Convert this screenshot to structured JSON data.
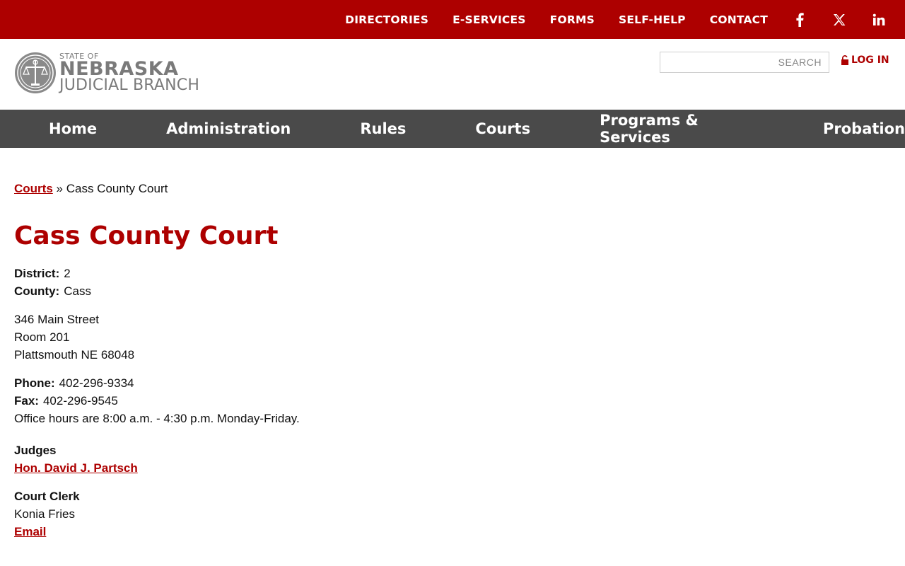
{
  "top_nav": {
    "items": [
      "DIRECTORIES",
      "E-SERVICES",
      "FORMS",
      "SELF-HELP",
      "CONTACT"
    ],
    "social": [
      "facebook-icon",
      "x-icon",
      "linkedin-icon"
    ]
  },
  "header": {
    "logo": {
      "state_of": "STATE OF",
      "nebraska": "NEBRASKA",
      "judicial_branch": "JUDICIAL BRANCH"
    },
    "search_placeholder": "SEARCH",
    "login_label": "LOG IN"
  },
  "main_nav": [
    "Home",
    "Administration",
    "Rules",
    "Courts",
    "Programs & Services",
    "Probation"
  ],
  "breadcrumb": {
    "link": "Courts",
    "separator": "»",
    "current": "Cass County Court"
  },
  "page_title": "Cass County Court",
  "details": {
    "district_label": "District:",
    "district_value": "2",
    "county_label": "County:",
    "county_value": "Cass",
    "address": [
      "346 Main Street",
      "Room 201",
      "Plattsmouth NE 68048"
    ],
    "phone_label": "Phone:",
    "phone_value": "402-296-9334",
    "fax_label": "Fax:",
    "fax_value": "402-296-9545",
    "hours": "Office hours are 8:00 a.m. - 4:30 p.m. Monday-Friday."
  },
  "judges": {
    "title": "Judges",
    "name": "Hon. David J. Partsch"
  },
  "clerk": {
    "title": "Court Clerk",
    "name": "Konia Fries",
    "email_label": "Email"
  },
  "colors": {
    "brand_red": "#ad0000",
    "nav_gray": "#4a4a4a"
  }
}
